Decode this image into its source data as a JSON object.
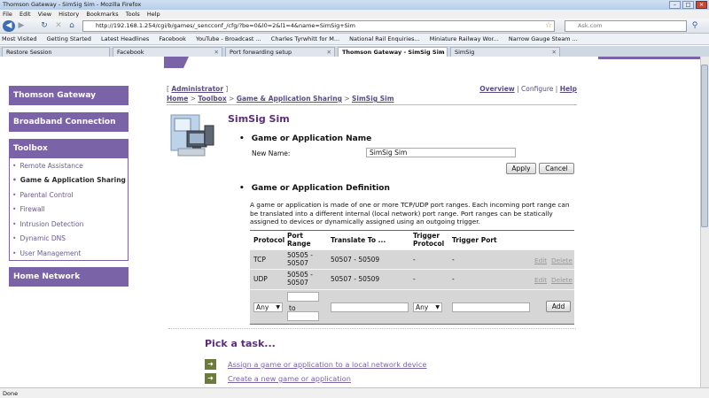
{
  "browser": {
    "window_title": "Thomson Gateway - SimSig Sim - Mozilla Firefox",
    "menu": [
      "File",
      "Edit",
      "View",
      "History",
      "Bookmarks",
      "Tools",
      "Help"
    ],
    "url": "http://192.168.1.254/cgi/b/games/_sencconf_/cfg/?be=0&l0=2&l1=4&name=SimSig+Sim",
    "search_placeholder": "Ask.com",
    "bookmarks": [
      "Most Visited",
      "Getting Started",
      "Latest Headlines",
      "Facebook",
      "YouTube - Broadcast ...",
      "Charles Tyrwhitt for M...",
      "National Rail Enquiries...",
      "Miniature Railway Wor...",
      "Narrow Gauge Steam ..."
    ],
    "tabs": [
      {
        "label": "Restore Session"
      },
      {
        "label": "Facebook"
      },
      {
        "label": "Port forwarding setup"
      },
      {
        "label": "Thomson Gateway - SimSig Sim"
      },
      {
        "label": "SimSig"
      }
    ],
    "status": "Done"
  },
  "sidebar": {
    "gateway": "Thomson Gateway",
    "broadband": "Broadband Connection",
    "toolbox": "Toolbox",
    "items": [
      "Remote Assistance",
      "Game & Application Sharing",
      "Parental Control",
      "Firewall",
      "Intrusion Detection",
      "Dynamic DNS",
      "User Management"
    ],
    "home_network": "Home Network"
  },
  "topnav": {
    "user": "Administrator",
    "crumbs": [
      "Home",
      "Toolbox",
      "Game & Application Sharing",
      "SimSig Sim"
    ],
    "links": [
      "Overview",
      "Configure",
      "Help"
    ]
  },
  "page": {
    "title": "SimSig Sim",
    "section1": "Game or Application Name",
    "new_name_label": "New Name:",
    "new_name_value": "SimSig Sim",
    "apply": "Apply",
    "cancel": "Cancel",
    "section2": "Game or Application Definition",
    "description": "A game or application is made of one or more TCP/UDP port ranges. Each incoming port range can be translated into a different internal (local network) port range. Port ranges can be statically assigned to devices or dynamically assigned using an outgoing trigger."
  },
  "table": {
    "headers": [
      "Protocol",
      "Port Range",
      "Translate To ...",
      "Trigger Protocol",
      "Trigger Port"
    ],
    "rows": [
      {
        "protocol": "TCP",
        "port_range": "50505 - 50507",
        "translate": "50507 - 50509",
        "trigger_protocol": "-",
        "trigger_port": "-",
        "edit": "Edit",
        "delete": "Delete"
      },
      {
        "protocol": "UDP",
        "port_range": "50505 - 50507",
        "translate": "50507 - 50509",
        "trigger_protocol": "-",
        "trigger_port": "-",
        "edit": "Edit",
        "delete": "Delete"
      }
    ],
    "add": {
      "protocol": "Any",
      "to": "to",
      "trigger_protocol": "Any",
      "button": "Add"
    }
  },
  "tasks": {
    "heading": "Pick a task...",
    "items": [
      "Assign a game or application to a local network device",
      "Create a new game or application"
    ]
  },
  "colors": {
    "brand": "#7b63a8",
    "title": "#5a2f7a"
  }
}
